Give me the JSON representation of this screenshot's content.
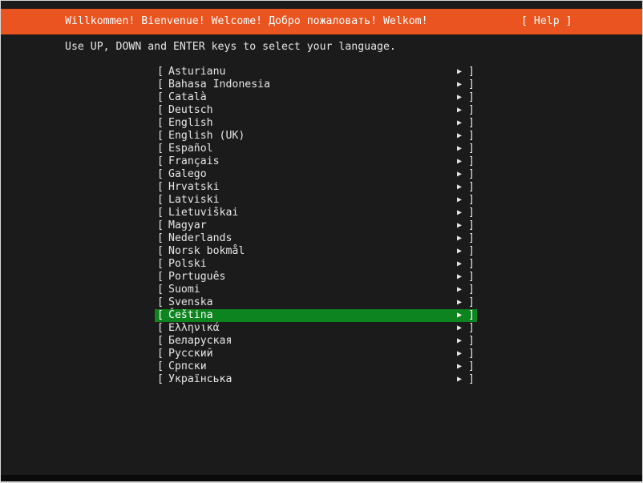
{
  "header": {
    "title": "Willkommen! Bienvenue! Welcome! Добро пожаловать! Welkom!",
    "help_label": "[ Help ]"
  },
  "instructions": "Use UP, DOWN and ENTER keys to select your language.",
  "languages": {
    "open_bracket": "[",
    "close_bracket": "]",
    "arrow_icon": "▶",
    "items": [
      {
        "label": "Asturianu"
      },
      {
        "label": "Bahasa Indonesia"
      },
      {
        "label": "Català"
      },
      {
        "label": "Deutsch"
      },
      {
        "label": "English"
      },
      {
        "label": "English (UK)"
      },
      {
        "label": "Español"
      },
      {
        "label": "Français"
      },
      {
        "label": "Galego"
      },
      {
        "label": "Hrvatski"
      },
      {
        "label": "Latviski"
      },
      {
        "label": "Lietuviškai"
      },
      {
        "label": "Magyar"
      },
      {
        "label": "Nederlands"
      },
      {
        "label": "Norsk bokmål"
      },
      {
        "label": "Polski"
      },
      {
        "label": "Português"
      },
      {
        "label": "Suomi"
      },
      {
        "label": "Svenska"
      },
      {
        "label": "Čeština"
      },
      {
        "label": "Ελληνικά"
      },
      {
        "label": "Беларуская"
      },
      {
        "label": "Русский"
      },
      {
        "label": "Српски"
      },
      {
        "label": "Українська"
      }
    ],
    "selected_index": 19
  },
  "colors": {
    "header_background": "#e95420",
    "selection_background": "#0e8420",
    "screen_background": "#1b1b1b",
    "text": "#e6e6e6"
  }
}
